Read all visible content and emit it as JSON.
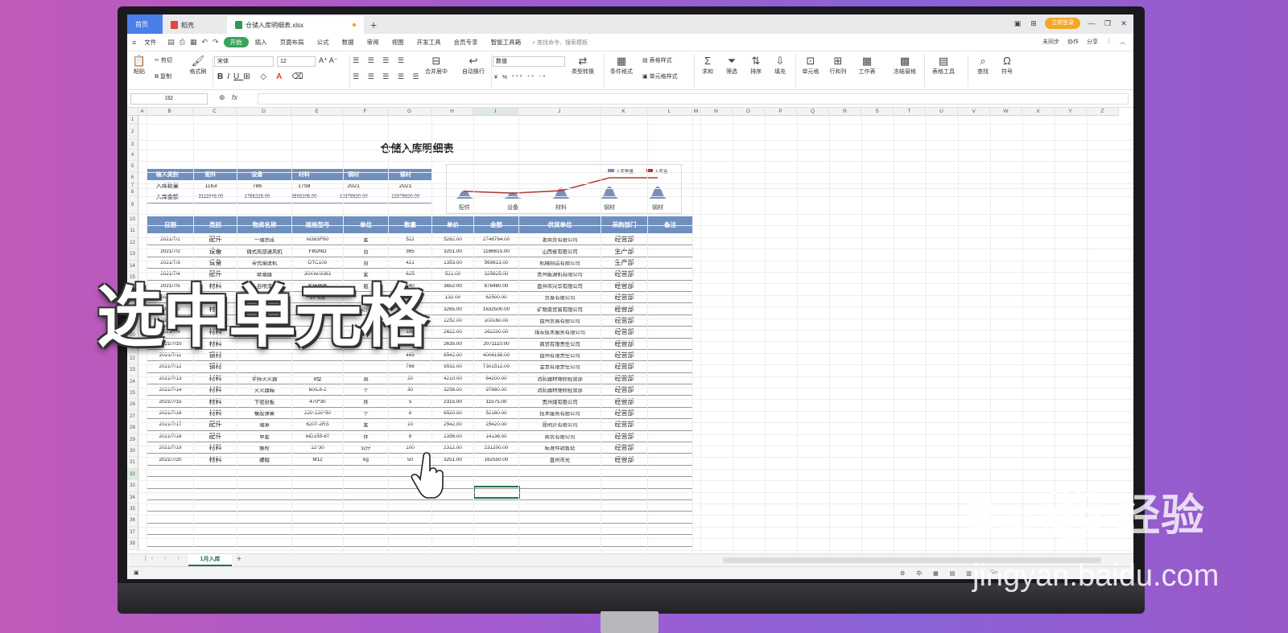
{
  "app": {
    "tabs": {
      "home": "首页",
      "docer": "稻壳",
      "file": "仓储入库明细表.xlsx"
    },
    "login": "立即登录",
    "menu": [
      "文件",
      "开始",
      "插入",
      "页面布局",
      "公式",
      "数据",
      "审阅",
      "视图",
      "开发工具",
      "会员专享",
      "智能工具箱"
    ],
    "search_cmd": "查找命令、搜索模板",
    "menu_right": [
      "未同步",
      "协作",
      "分享"
    ]
  },
  "ribbon": {
    "paste": "粘贴",
    "cut": "剪切",
    "copy": "复制",
    "format_painter": "格式刷",
    "font": "宋体",
    "size": "12",
    "merge": "合并居中",
    "wrap": "自动换行",
    "numfmt": "数值",
    "type_convert": "类型转换",
    "cond_format": "条件格式",
    "table_style": "表格样式",
    "cell_style": "单元格样式",
    "sum": "求和",
    "filter": "筛选",
    "sort": "排序",
    "fill": "填充",
    "cell": "单元格",
    "rowcol": "行和列",
    "worksheet": "工作表",
    "freeze": "冻结窗格",
    "table_tools": "表格工具",
    "find": "查找",
    "symbol": "符号"
  },
  "formula_bar": {
    "cell_ref": "I32",
    "fx": "fx"
  },
  "columns": [
    "A",
    "B",
    "C",
    "D",
    "E",
    "F",
    "G",
    "H",
    "I",
    "J",
    "K",
    "L",
    "M",
    "N",
    "O",
    "P",
    "Q",
    "R",
    "S",
    "T",
    "U",
    "V",
    "W",
    "X",
    "Y",
    "Z"
  ],
  "rows": [
    "1",
    "2",
    "3",
    "4",
    "5",
    "6",
    "7",
    "8",
    "9",
    "10",
    "11",
    "12",
    "13",
    "14",
    "15",
    "16",
    "17",
    "18",
    "19",
    "20",
    "21",
    "22",
    "23",
    "24",
    "25",
    "26",
    "27",
    "28",
    "29",
    "30",
    "31",
    "32",
    "33",
    "34",
    "35",
    "36",
    "37",
    "38"
  ],
  "sheet_title": "仓储入库明细表",
  "summary": {
    "header": [
      "输入类别",
      "配件",
      "设备",
      "材料",
      "钢材",
      "钢材"
    ],
    "qty_label": "入库数量",
    "qty": [
      "1163",
      "786",
      "1758",
      "2021",
      "2021"
    ],
    "amt_label": "入库金额",
    "amt": [
      "3111948.00",
      "1756228.00",
      "3593205.00",
      "13378820.00",
      "13378820.00"
    ]
  },
  "chart_data": {
    "type": "area",
    "categories": [
      "配件",
      "设备",
      "材料",
      "钢材",
      "钢材"
    ],
    "series": [
      {
        "name": "入库数量",
        "values": [
          1163,
          786,
          1758,
          2021,
          2021
        ]
      },
      {
        "name": "入库金额",
        "values": [
          3111948,
          1756228,
          3593205,
          13378820,
          13378820
        ]
      }
    ],
    "legend": "top-right",
    "legend_labels": [
      "入库数量",
      "入库金"
    ]
  },
  "table": {
    "headers": [
      "日期",
      "类别",
      "物资名称",
      "规格型号",
      "单位",
      "数量",
      "单价",
      "金额",
      "供货单位",
      "采购部门",
      "备注"
    ],
    "rows": [
      [
        "2021/7/1",
        "配件",
        "一轴总成",
        "M38SF60",
        "套",
        "522",
        "5262.00",
        "2746764.00",
        "发商贸有限公司",
        "经营部",
        ""
      ],
      [
        "2021/7/2",
        "设备",
        "微式局部通风机",
        "FBDNO",
        "台",
        "365",
        "3251.00",
        "1186615.00",
        "山西省有限公司",
        "生产部",
        ""
      ],
      [
        "2021/7/3",
        "设备",
        "带式输送机",
        "DTC100",
        "台",
        "421",
        "1353.00",
        "569613.00",
        "机械制造有限公司",
        "生产部",
        ""
      ],
      [
        "2021/7/4",
        "配件",
        "联轴器",
        "30XW/3063",
        "套",
        "625",
        "521.00",
        "325625.00",
        "贵州能源机有限公司",
        "经营部",
        ""
      ],
      [
        "2021/7/5",
        "材料",
        "自喷漆",
        "各种颜色",
        "瓶",
        "240",
        "3652.00",
        "876480.00",
        "盘州市兴华有限公司",
        "经营部",
        ""
      ],
      [
        "2021/7/6",
        "材料",
        "手拉葫芦",
        "5T*6米",
        "台",
        "625",
        "132.00",
        "82500.00",
        "贸易有限公司",
        "经营部",
        ""
      ],
      [
        "2021/7/7",
        "材料",
        "钢钎",
        "纯钢",
        "公斤",
        "500",
        "3265.00",
        "1632500.00",
        "矿物资贸易有限公司",
        "经营部",
        ""
      ],
      [
        "2021/7/8",
        "材料",
        "",
        "",
        "",
        "80",
        "1252.00",
        "100160.00",
        "盘州贸易有限公司",
        "经营部",
        ""
      ],
      [
        "2021/7/9",
        "材料",
        "",
        "",
        "",
        "100",
        "2622.00",
        "262200.00",
        "煤炭技术服务有限公司",
        "经营部",
        ""
      ],
      [
        "2021/7/10",
        "材料",
        "",
        "",
        "",
        "786",
        "2635.00",
        "2071110.00",
        "商贸有限责任公司",
        "经营部",
        ""
      ],
      [
        "2021/7/11",
        "钢材",
        "",
        "",
        "",
        "469",
        "8542.00",
        "4006198.00",
        "盘州有限责任公司",
        "经营部",
        ""
      ],
      [
        "2021/7/12",
        "钢材",
        "",
        "",
        "",
        "766",
        "9532.00",
        "7301512.00",
        "金贵有限责任公司",
        "经营部",
        ""
      ],
      [
        "2021/7/13",
        "材料",
        "手持灭火器",
        "8型",
        "具",
        "20",
        "4210.00",
        "84200.00",
        "消防器材维修经营部",
        "经营部",
        ""
      ],
      [
        "2021/7/14",
        "材料",
        "灭火器箱",
        "MXL8-2",
        "个",
        "30",
        "3256.00",
        "97680.00",
        "消防器材维修经营部",
        "经营部",
        ""
      ],
      [
        "2021/7/15",
        "材料",
        "下密封板",
        "470*30",
        "件",
        "5",
        "2315.00",
        "11575.00",
        "贵州煤有限公司",
        "经营部",
        ""
      ],
      [
        "2021/7/16",
        "材料",
        "橡胶弹簧",
        "220*220*50",
        "个",
        "8",
        "6520.00",
        "52160.00",
        "技术服务有限公司",
        "经营部",
        ""
      ],
      [
        "2021/7/17",
        "配件",
        "轴承",
        "6207-2RS",
        "套",
        "10",
        "2542.00",
        "25420.00",
        "昆明贝有限公司",
        "经营部",
        ""
      ],
      [
        "2021/7/18",
        "配件",
        "甲套",
        "MD155-67",
        "件",
        "6",
        "2356.00",
        "14136.00",
        "商贸有限公司",
        "经营部",
        ""
      ],
      [
        "2021/7/19",
        "材料",
        "螺栓",
        "12*30",
        "公斤",
        "100",
        "2312.00",
        "231200.00",
        "标准件销售处",
        "经营部",
        ""
      ],
      [
        "2021/7/20",
        "材料",
        "螺帽",
        "M12",
        "kg",
        "50",
        "3251.00",
        "162550.00",
        "盘州市光",
        "经营部",
        ""
      ]
    ]
  },
  "sheet_tab": "1月入库",
  "status": {
    "zoom": "55%"
  },
  "overlay_text": "选中单元格",
  "watermark": {
    "brand": "Bai du 经验",
    "url": "jingyan.baidu.com"
  }
}
